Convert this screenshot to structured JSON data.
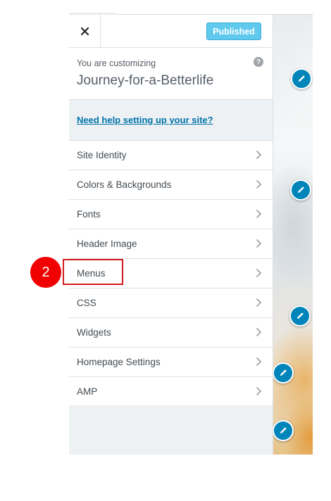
{
  "header": {
    "publish_label": "Published"
  },
  "info": {
    "customizing_label": "You are customizing",
    "site_title": "Journey-for-a-Betterlife",
    "help_icon_glyph": "?"
  },
  "help_link": "Need help setting up your site?",
  "menu": {
    "items": [
      {
        "label": "Site Identity"
      },
      {
        "label": "Colors & Backgrounds"
      },
      {
        "label": "Fonts"
      },
      {
        "label": "Header Image"
      },
      {
        "label": "Menus"
      },
      {
        "label": "CSS"
      },
      {
        "label": "Widgets"
      },
      {
        "label": "Homepage Settings"
      },
      {
        "label": "AMP"
      }
    ]
  },
  "annotation": {
    "step_number": "2"
  },
  "icons": {
    "close": "close-icon",
    "chevron": "chevron-right-icon",
    "edit_pin": "pencil-icon"
  },
  "colors": {
    "publish_button": "#5fc9ee",
    "link": "#0073aa",
    "edit_pin": "#0085ba",
    "annotation": "#f00000"
  }
}
